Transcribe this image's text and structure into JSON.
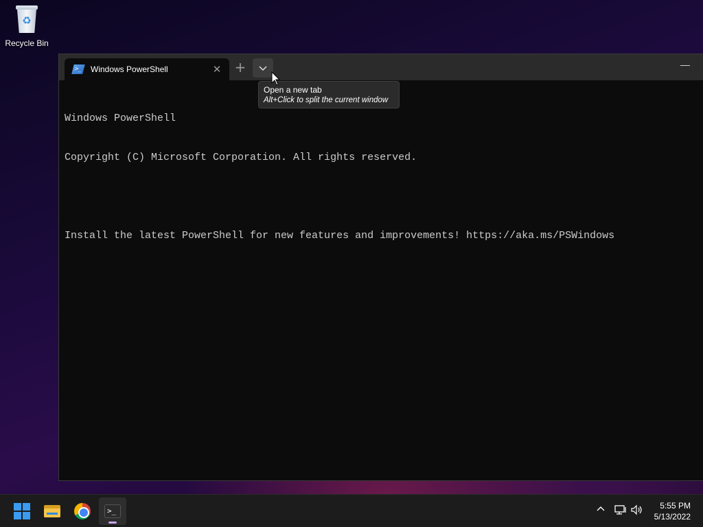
{
  "desktop": {
    "recycle_bin_label": "Recycle Bin"
  },
  "terminal": {
    "tab_title": "Windows PowerShell",
    "tab_icon": "powershell-icon",
    "close_glyph": "✕",
    "new_tab_glyph": "+",
    "minimize_glyph": "—",
    "console_lines": [
      "Windows PowerShell",
      "Copyright (C) Microsoft Corporation. All rights reserved.",
      "",
      "Install the latest PowerShell for new features and improvements! https://aka.ms/PSWindows"
    ]
  },
  "tooltip": {
    "line1": "Open a new tab",
    "line2": "Alt+Click to split the current window"
  },
  "taskbar": {
    "apps": [
      "start-icon",
      "file-explorer-icon",
      "chrome-icon",
      "terminal-icon"
    ],
    "active_app": "terminal-icon",
    "time": "5:55 PM",
    "date": "5/13/2022",
    "tray_icons": [
      "chevron-up-icon",
      "network-icon",
      "volume-icon"
    ]
  },
  "colors": {
    "accent": "#3a9bf0",
    "console_bg": "#0c0c0c",
    "console_fg": "#cccccc",
    "active_indicator": "#c9a6f2"
  }
}
